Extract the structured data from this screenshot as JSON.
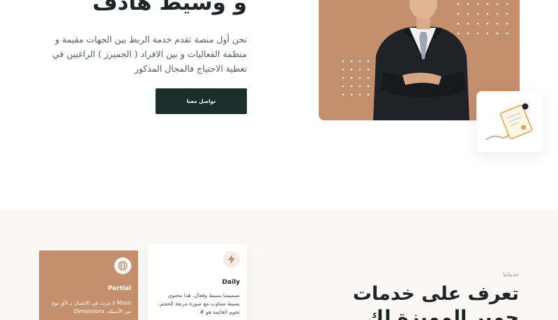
{
  "hero": {
    "title": "و وسيط هادف",
    "description": "نحن أول منصة تقدم خدمة الربط بين الجهات مقيمة و منظمة الفعاليات و بين الافراد ( الجميرز ) الراغبين في تغطية الاحتياج فالمجال المذكور",
    "contact_button": "تواصل معنا"
  },
  "badge": {
    "icon": "certificate-icon"
  },
  "services": {
    "tag": "خدماتنا",
    "title_line1": "تعرف على خدمات",
    "title_line2": "جمير المميزة لك",
    "cards": [
      {
        "title": "Daily",
        "icon": "bolt-icon",
        "text": "تصميمنا بسيط وفعال. هذا محتوى بسيط متناوب مع صورة مربعة الحجم. تحوم القائمة هو #"
      },
      {
        "title": "Partial",
        "icon": "globe-icon",
        "text": "Moon لا تتردد في الاتصال بـ لأي نوع من الأسئلة. Dimensions"
      }
    ]
  },
  "colors": {
    "accent": "#c48f6c",
    "dark_button": "#1b302b",
    "section_bg": "#faf8f4"
  }
}
